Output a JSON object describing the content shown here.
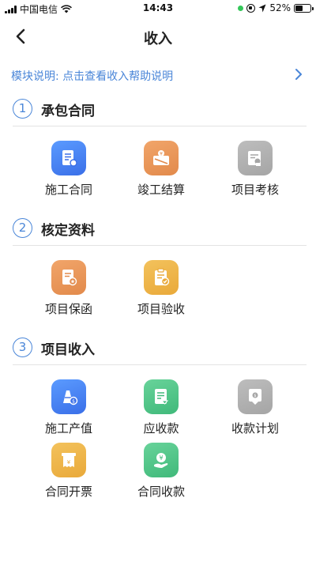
{
  "status_bar": {
    "carrier": "中国电信",
    "time": "14:43",
    "battery": "52%",
    "battery_level": 0.52
  },
  "nav": {
    "title": "收入",
    "back_icon": "chevron-left-icon"
  },
  "help": {
    "text": "模块说明: 点击查看收入帮助说明",
    "icon": "chevron-right-icon"
  },
  "colors": {
    "accent": "#4a86d8",
    "blue": "#3a6fe8",
    "orange": "#e28a4b",
    "gray": "#a5a5a5",
    "amber": "#e9a93a",
    "green": "#40b97a"
  },
  "sections": [
    {
      "number": "1",
      "title": "承包合同",
      "items": [
        {
          "label": "施工合同",
          "icon": "contract-document-icon",
          "color": "blue"
        },
        {
          "label": "竣工结算",
          "icon": "settlement-box-icon",
          "color": "orange"
        },
        {
          "label": "项目考核",
          "icon": "assessment-certificate-icon",
          "color": "gray"
        }
      ]
    },
    {
      "number": "2",
      "title": "核定资料",
      "items": [
        {
          "label": "项目保函",
          "icon": "guarantee-letter-icon",
          "color": "orange"
        },
        {
          "label": "项目验收",
          "icon": "acceptance-clipboard-icon",
          "color": "amber"
        }
      ]
    },
    {
      "number": "3",
      "title": "项目收入",
      "items": [
        {
          "label": "施工产值",
          "icon": "output-value-icon",
          "color": "blue"
        },
        {
          "label": "应收款",
          "icon": "receivable-document-icon",
          "color": "green"
        },
        {
          "label": "收款计划",
          "icon": "collection-plan-icon",
          "color": "gray"
        },
        {
          "label": "合同开票",
          "icon": "invoice-icon",
          "color": "amber"
        },
        {
          "label": "合同收款",
          "icon": "payment-received-icon",
          "color": "green"
        }
      ]
    }
  ]
}
